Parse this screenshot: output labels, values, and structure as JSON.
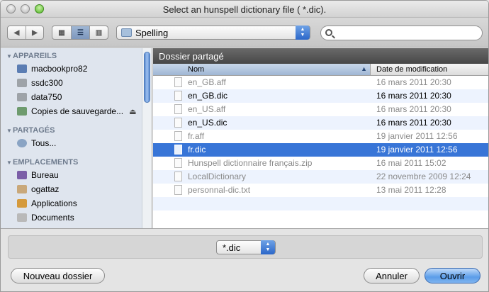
{
  "window": {
    "title": "Select an hunspell dictionary file ( *.dic)."
  },
  "toolbar": {
    "back_icon": "arrow-left-icon",
    "forward_icon": "arrow-right-icon",
    "view_modes": [
      "icon-view-icon",
      "list-view-icon",
      "column-view-icon"
    ],
    "active_view": "list",
    "location": "Spelling",
    "search_placeholder": ""
  },
  "sidebar": {
    "sections": [
      {
        "label": "APPAREILS",
        "items": [
          {
            "label": "macbookpro82",
            "icon": "laptop-icon"
          },
          {
            "label": "ssdc300",
            "icon": "drive-icon"
          },
          {
            "label": "data750",
            "icon": "drive-icon"
          },
          {
            "label": "Copies de sauvegarde...",
            "icon": "backup-drive-icon",
            "eject": "eject-icon"
          }
        ]
      },
      {
        "label": "PARTAGÉS",
        "items": [
          {
            "label": "Tous...",
            "icon": "network-icon"
          }
        ]
      },
      {
        "label": "EMPLACEMENTS",
        "items": [
          {
            "label": "Bureau",
            "icon": "desktop-icon"
          },
          {
            "label": "ogattaz",
            "icon": "home-icon"
          },
          {
            "label": "Applications",
            "icon": "applications-icon"
          },
          {
            "label": "Documents",
            "icon": "documents-icon"
          }
        ]
      }
    ]
  },
  "files": {
    "header": "Dossier partagé",
    "columns": {
      "name": "Nom",
      "date": "Date de modification"
    },
    "rows": [
      {
        "name": "en_GB.aff",
        "date": "16 mars 2011 20:30",
        "enabled": false
      },
      {
        "name": "en_GB.dic",
        "date": "16 mars 2011 20:30",
        "enabled": true
      },
      {
        "name": "en_US.aff",
        "date": "16 mars 2011 20:30",
        "enabled": false
      },
      {
        "name": "en_US.dic",
        "date": "16 mars 2011 20:30",
        "enabled": true
      },
      {
        "name": "fr.aff",
        "date": "19 janvier 2011 12:56",
        "enabled": false
      },
      {
        "name": "fr.dic",
        "date": "19 janvier 2011 12:56",
        "enabled": true,
        "selected": true
      },
      {
        "name": "Hunspell dictionnaire français.zip",
        "date": "16 mai 2011 15:02",
        "enabled": false
      },
      {
        "name": "LocalDictionary",
        "date": "22 novembre 2009 12:24",
        "enabled": false
      },
      {
        "name": "personnal-dic.txt",
        "date": "13 mai 2011 12:28",
        "enabled": false
      }
    ]
  },
  "filter": {
    "value": "*.dic"
  },
  "buttons": {
    "new_folder": "Nouveau dossier",
    "cancel": "Annuler",
    "open": "Ouvrir"
  },
  "colors": {
    "selection": "#3875d7",
    "header_bg": "#4f4f4f",
    "sidebar_bg": "#dfe5ee"
  }
}
